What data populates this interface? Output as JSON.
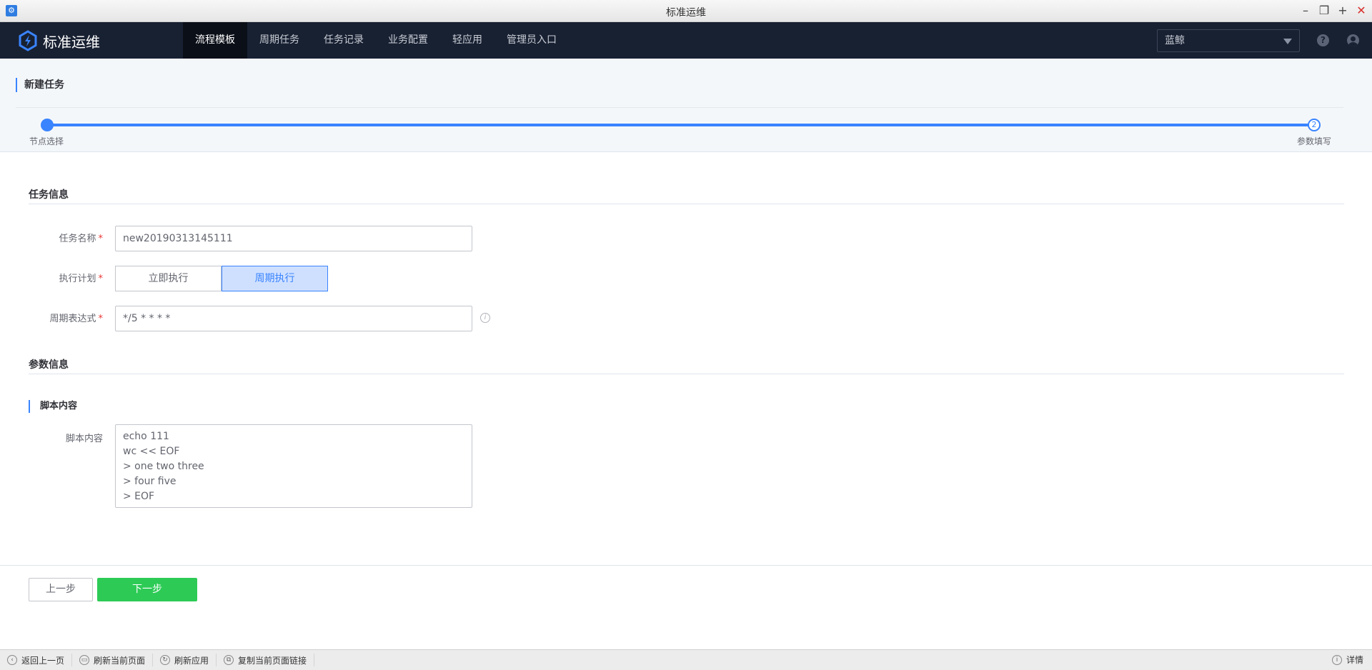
{
  "window": {
    "title": "标准运维"
  },
  "nav": {
    "logo_text": "标准运维",
    "items": [
      "流程模板",
      "周期任务",
      "任务记录",
      "业务配置",
      "轻应用",
      "管理员入口"
    ],
    "active_index": 0,
    "business_select": "蓝鲸"
  },
  "page": {
    "title": "新建任务",
    "steps": [
      {
        "label": "节点选择"
      },
      {
        "label": "参数填写",
        "number": "2"
      }
    ]
  },
  "task_info": {
    "section_title": "任务信息",
    "name_label": "任务名称",
    "name_value": "new20190313145111",
    "plan_label": "执行计划",
    "plan_options": [
      "立即执行",
      "周期执行"
    ],
    "plan_selected": "周期执行",
    "cron_label": "周期表达式",
    "cron_value": "*/5 * * * *",
    "required_mark": "*",
    "info_icon": "i"
  },
  "param_info": {
    "section_title": "参数信息",
    "group_title": "脚本内容",
    "script_label": "脚本内容",
    "script_lines": [
      "echo 111",
      "wc << EOF",
      "> one two three",
      "> four five",
      "> EOF"
    ]
  },
  "actions": {
    "prev": "上一步",
    "next": "下一步"
  },
  "statusbar": {
    "items": [
      "返回上一页",
      "刷新当前页面",
      "刷新应用",
      "复制当前页面链接"
    ],
    "detail": "详情"
  },
  "colors": {
    "primary": "#3a84ff",
    "success": "#2dcb56",
    "nav_bg": "#182132"
  }
}
